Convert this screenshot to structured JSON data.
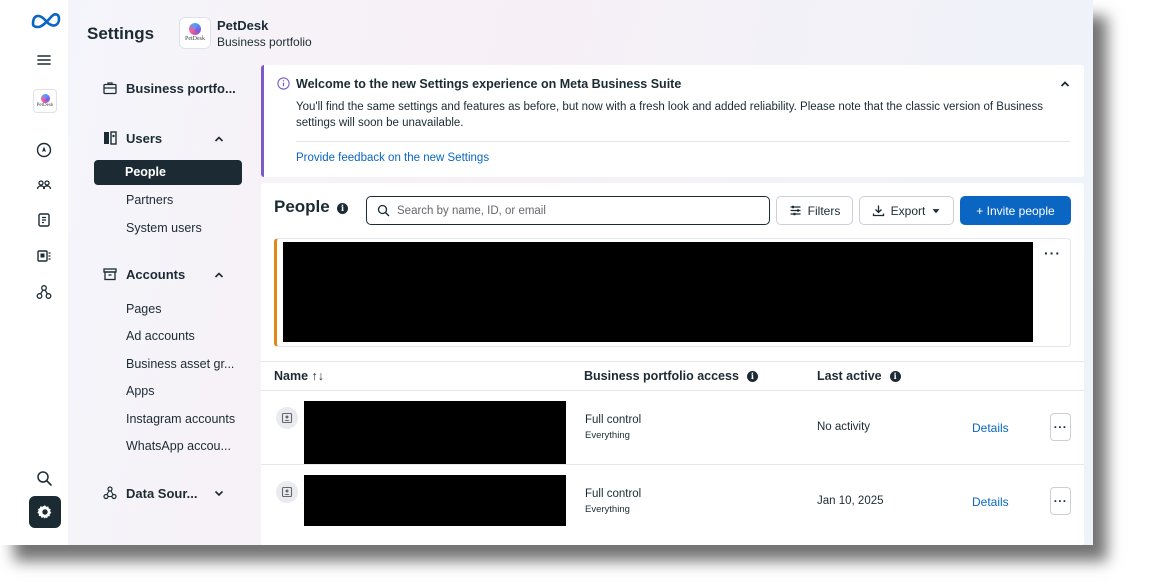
{
  "header": {
    "title": "Settings",
    "portfolio_logo_text": "PetDesk",
    "portfolio_name": "PetDesk",
    "portfolio_type": "Business portfolio"
  },
  "rail": {
    "thumb_text": "PetDesk",
    "icons": [
      "meta-logo-icon",
      "menu-icon",
      "business-icon",
      "compass-icon",
      "people-icon",
      "content-icon",
      "ads-icon",
      "connections-icon",
      "search-icon",
      "gear-icon"
    ]
  },
  "nav": {
    "business_portfolio": "Business portfo...",
    "users": {
      "label": "Users",
      "items": [
        "People",
        "Partners",
        "System users"
      ]
    },
    "accounts": {
      "label": "Accounts",
      "items": [
        "Pages",
        "Ad accounts",
        "Business asset gr...",
        "Apps",
        "Instagram accounts",
        "WhatsApp accou..."
      ]
    },
    "data_sources": "Data Sour..."
  },
  "banner": {
    "title": "Welcome to the new Settings experience on Meta Business Suite",
    "body": "You'll find the same settings and features as before, but now with a fresh look and added reliability. Please note that the classic version of Business settings will soon be unavailable.",
    "link": "Provide feedback on the new Settings"
  },
  "people": {
    "title": "People",
    "search_placeholder": "Search by name, ID, or email",
    "filters_label": "Filters",
    "export_label": "Export",
    "invite_label": "+ Invite people",
    "more": "···",
    "columns": {
      "name": "Name ↑↓",
      "access": "Business portfolio access",
      "last_active": "Last active"
    },
    "rows": [
      {
        "access": "Full control",
        "access_sub": "Everything",
        "last_active": "No activity",
        "details": "Details",
        "more": "···"
      },
      {
        "access": "Full control",
        "access_sub": "Everything",
        "last_active": "Jan 10, 2025",
        "details": "Details",
        "more": "···"
      }
    ]
  },
  "colors": {
    "accent": "#0a66c2",
    "dark": "#1c2b33",
    "banner_border": "#7a5cc8",
    "card_border": "#e0891a"
  }
}
